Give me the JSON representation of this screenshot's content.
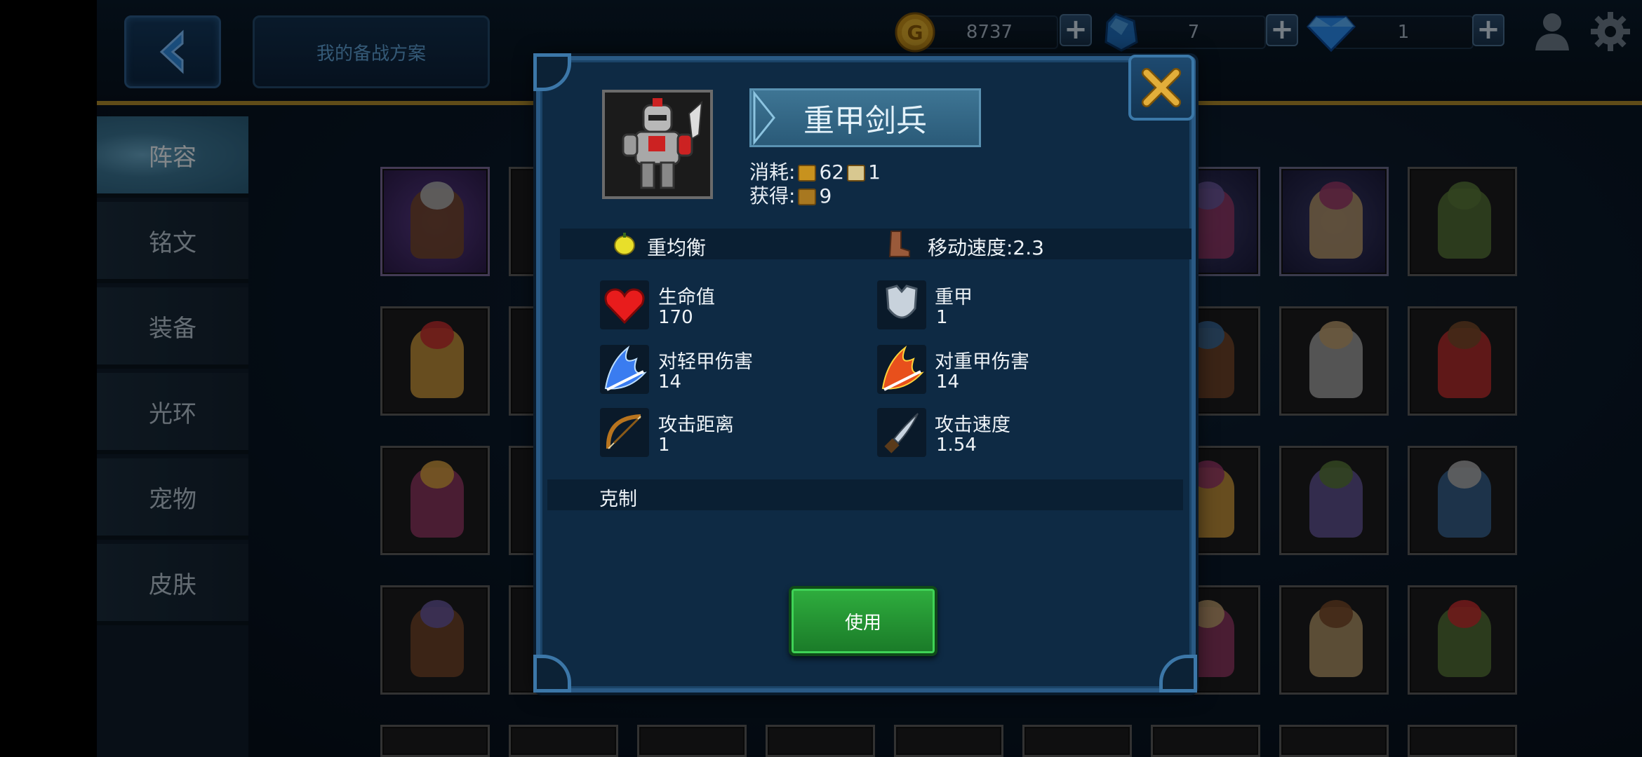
{
  "topbar": {
    "plan_label": "我的备战方案",
    "gold_value": "8737",
    "gem_value": "7",
    "diamond_value": "1"
  },
  "sidebar": {
    "items": [
      {
        "label": "阵容"
      },
      {
        "label": "铭文"
      },
      {
        "label": "装备"
      },
      {
        "label": "光环"
      },
      {
        "label": "宠物"
      },
      {
        "label": "皮肤"
      }
    ]
  },
  "dialog": {
    "unit_name": "重甲剑兵",
    "cost_label": "消耗:",
    "cost_gold": "62",
    "cost_pop": "1",
    "gain_label": "获得:",
    "gain_value": "9",
    "balance_label": "重均衡",
    "speed_label": "移动速度:2.3",
    "stats": [
      {
        "label": "生命值",
        "value": "170",
        "icon": "heart-icon"
      },
      {
        "label": "重甲",
        "value": "1",
        "icon": "armor-icon"
      },
      {
        "label": "对轻甲伤害",
        "value": "14",
        "icon": "blue-slash-icon"
      },
      {
        "label": "对重甲伤害",
        "value": "14",
        "icon": "fire-slash-icon"
      },
      {
        "label": "攻击距离",
        "value": "1",
        "icon": "bow-icon"
      },
      {
        "label": "攻击速度",
        "value": "1.54",
        "icon": "dagger-icon"
      }
    ],
    "counter_label": "克制",
    "use_label": "使用"
  },
  "colors": {
    "accent_gold": "#b08a2c",
    "dialog_bg": "#0e2a44",
    "use_green": "#2fae3e"
  }
}
